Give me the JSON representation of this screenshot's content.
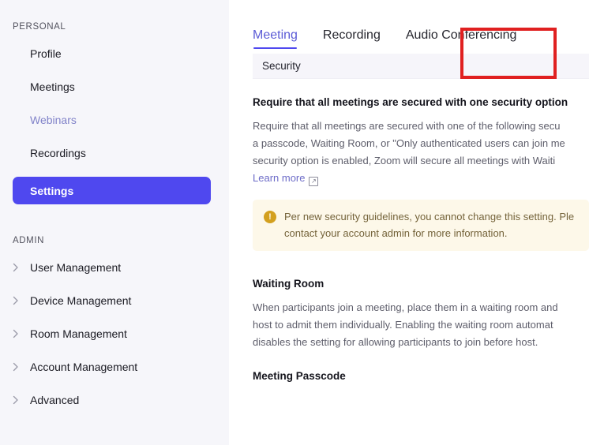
{
  "sidebar": {
    "personal": {
      "label": "PERSONAL",
      "items": [
        {
          "label": "Profile",
          "state": "default"
        },
        {
          "label": "Meetings",
          "state": "default"
        },
        {
          "label": "Webinars",
          "state": "visited"
        },
        {
          "label": "Recordings",
          "state": "default"
        },
        {
          "label": "Settings",
          "state": "active"
        }
      ]
    },
    "admin": {
      "label": "ADMIN",
      "items": [
        {
          "label": "User Management",
          "icon": "chevron-right-icon"
        },
        {
          "label": "Device Management",
          "icon": "chevron-right-icon"
        },
        {
          "label": "Room Management",
          "icon": "chevron-right-icon"
        },
        {
          "label": "Account Management",
          "icon": "chevron-right-icon"
        },
        {
          "label": "Advanced",
          "icon": "chevron-right-icon"
        }
      ]
    }
  },
  "tabs": [
    {
      "label": "Meeting",
      "active": true
    },
    {
      "label": "Recording",
      "active": false
    },
    {
      "label": "Audio Conferencing",
      "active": false
    }
  ],
  "section": {
    "title": "Security"
  },
  "settings": [
    {
      "title": "Require that all meetings are secured with one security option",
      "description_lines": [
        "Require that all meetings are secured with one of the following secu",
        "a passcode, Waiting Room, or \"Only authenticated users can join me",
        "security option is enabled, Zoom will secure all meetings with Waiti"
      ],
      "learn_more": "Learn more",
      "learn_more_icon": "external-link-icon",
      "notice": {
        "icon": "warning-icon",
        "lines": [
          "Per new security guidelines, you cannot change this setting. Ple",
          "contact your account admin for more information."
        ]
      }
    },
    {
      "title": "Waiting Room",
      "description_lines": [
        "When participants join a meeting, place them in a waiting room and",
        "host to admit them individually. Enabling the waiting room automat",
        "disables the setting for allowing participants to join before host."
      ]
    },
    {
      "title": "Meeting Passcode",
      "description_lines": []
    }
  ],
  "annotation": {
    "target": "Meeting",
    "color": "#e02020"
  },
  "colors": {
    "accent": "#4f48ef",
    "tab_active": "#5b5bd6",
    "sidebar_bg": "#f6f6fa",
    "notice_bg": "#fdf8e9",
    "notice_icon": "#d3a01f",
    "annotation": "#e02020"
  }
}
